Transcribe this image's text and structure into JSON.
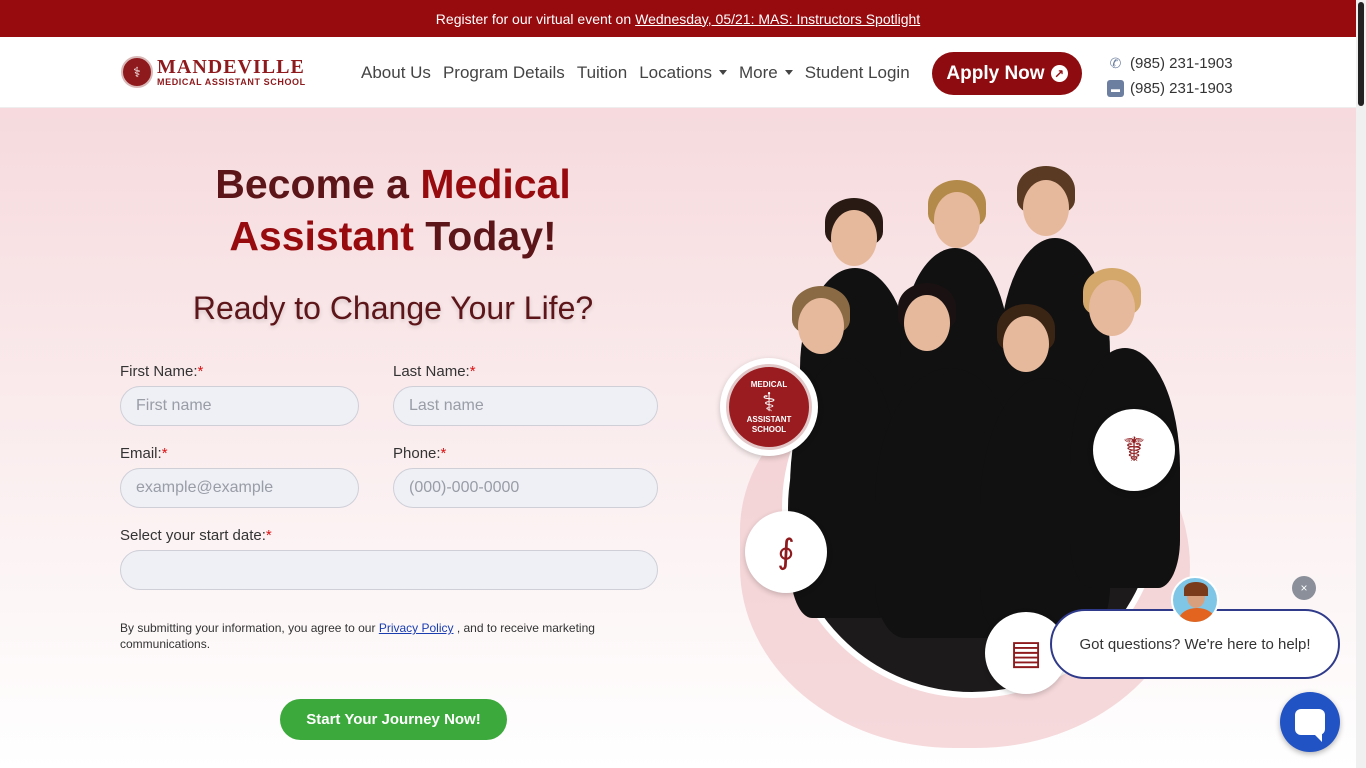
{
  "announcement": {
    "prefix": "Register for our virtual event on",
    "link": "Wednesday, 05/21: MAS: Instructors Spotlight"
  },
  "logo": {
    "main": "MANDEVILLE",
    "sub": "MEDICAL ASSISTANT SCHOOL"
  },
  "nav": {
    "items": [
      {
        "label": "About Us",
        "dropdown": false
      },
      {
        "label": "Program Details",
        "dropdown": false
      },
      {
        "label": "Tuition",
        "dropdown": false
      },
      {
        "label": "Locations",
        "dropdown": true
      },
      {
        "label": "More",
        "dropdown": true
      },
      {
        "label": "Student Login",
        "dropdown": false
      }
    ],
    "apply": "Apply Now"
  },
  "contact": {
    "phone": "(985) 231-1903",
    "sms": "(985) 231-1903"
  },
  "hero": {
    "headline_1": "Become a",
    "headline_accent_1": "Medical",
    "headline_accent_2": "Assistant",
    "headline_2": "Today!",
    "subhead": "Ready to Change Your Life?"
  },
  "form": {
    "first_name_label": "First Name:",
    "first_name_placeholder": "First name",
    "last_name_label": "Last Name:",
    "last_name_placeholder": "Last name",
    "email_label": "Email:",
    "email_placeholder": "example@example",
    "phone_label": "Phone:",
    "phone_placeholder": "(000)-000-0000",
    "start_date_label": "Select your start date:",
    "required_mark": "*",
    "disclaimer_prefix": "By submitting your information, you agree to our",
    "privacy_link": "Privacy Policy",
    "disclaimer_suffix": ", and to receive marketing communications.",
    "submit": "Start Your Journey Now!"
  },
  "seal": {
    "top": "MEDICAL",
    "bottom": "ASSISTANT SCHOOL"
  },
  "chat": {
    "message": "Got questions? We're here to help!",
    "close": "×"
  },
  "colors": {
    "brand": "#970a0e",
    "cta_green": "#3ba93b",
    "chat_blue": "#2253c4"
  }
}
